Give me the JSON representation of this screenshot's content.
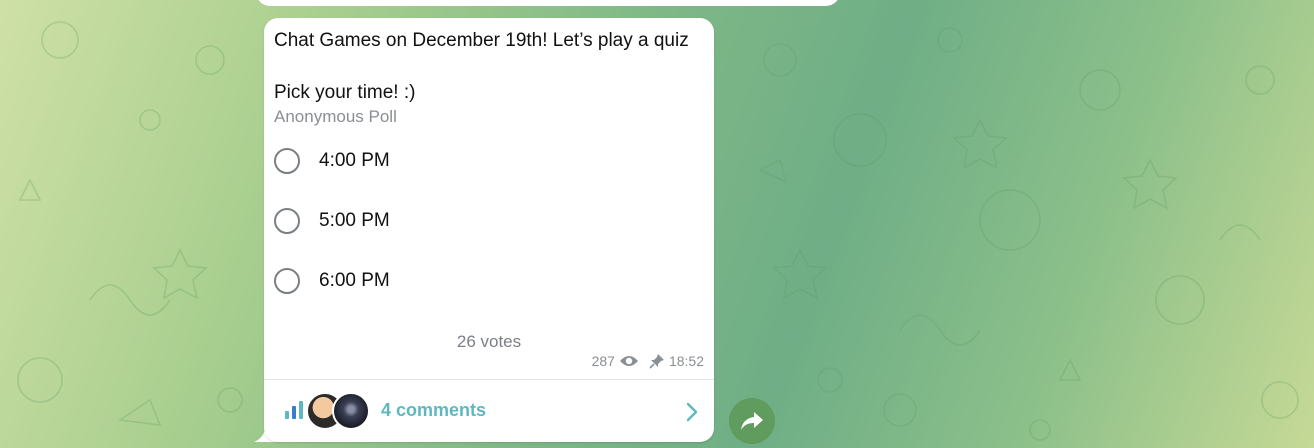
{
  "poll": {
    "question": "Chat Games on December 19th! Let’s play a quiz\n\nPick your time! :)",
    "type_label": "Anonymous Poll",
    "options": [
      {
        "label": "4:00 PM"
      },
      {
        "label": "5:00 PM"
      },
      {
        "label": "6:00 PM"
      }
    ],
    "votes_label": "26 votes"
  },
  "meta": {
    "views": "287",
    "time": "18:52"
  },
  "comments": {
    "label": "4 comments"
  },
  "colors": {
    "accent": "#5fb8c0",
    "bubble": "#ffffff",
    "share_button": "#5b9650"
  },
  "icons": {
    "views": "eye-icon",
    "pinned": "pin-icon",
    "stats": "bar-chart-icon",
    "open": "chevron-right-icon",
    "share": "share-arrow-icon"
  }
}
